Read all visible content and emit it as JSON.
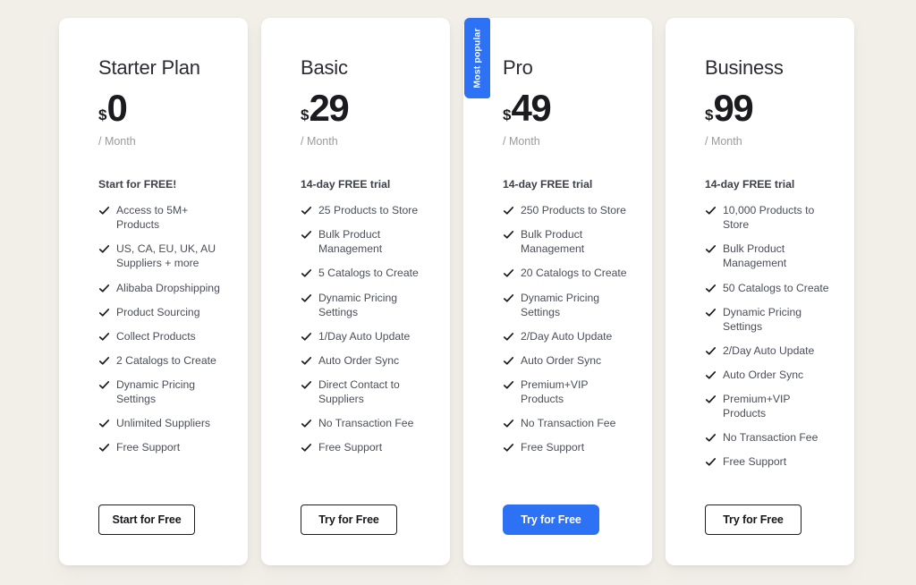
{
  "theme": {
    "page_background": "#f2efe9",
    "card_background": "#ffffff",
    "accent_blue": "#2d71f5",
    "text_dark": "#1a1a1f",
    "text_muted": "#9a9a9f",
    "feature_text": "#4a4f58"
  },
  "plans": [
    {
      "name": "Starter Plan",
      "currency": "$",
      "amount": "0",
      "period": "/ Month",
      "trial": "Start for FREE!",
      "badge": null,
      "features": [
        "Access to 5M+ Products",
        "US, CA, EU, UK, AU Suppliers + more",
        "Alibaba Dropshipping",
        "Product Sourcing",
        "Collect Products",
        "2 Catalogs to Create",
        "Dynamic Pricing Settings",
        "Unlimited Suppliers",
        "Free Support"
      ],
      "cta_label": "Start for Free",
      "cta_style": "outline"
    },
    {
      "name": "Basic",
      "currency": "$",
      "amount": "29",
      "period": "/ Month",
      "trial": "14-day FREE trial",
      "badge": null,
      "features": [
        "25 Products to Store",
        "Bulk Product Management",
        "5 Catalogs to Create",
        "Dynamic Pricing Settings",
        "1/Day Auto Update",
        "Auto Order Sync",
        "Direct Contact to Suppliers",
        "No Transaction Fee",
        "Free Support"
      ],
      "cta_label": "Try for Free",
      "cta_style": "outline"
    },
    {
      "name": "Pro",
      "currency": "$",
      "amount": "49",
      "period": "/ Month",
      "trial": "14-day FREE trial",
      "badge": "Most popular",
      "features": [
        "250 Products to Store",
        "Bulk Product Management",
        "20 Catalogs to Create",
        "Dynamic Pricing Settings",
        "2/Day Auto Update",
        "Auto Order Sync",
        "Premium+VIP Products",
        "No Transaction Fee",
        "Free Support"
      ],
      "cta_label": "Try for Free",
      "cta_style": "solid"
    },
    {
      "name": "Business",
      "currency": "$",
      "amount": "99",
      "period": "/ Month",
      "trial": "14-day FREE trial",
      "badge": null,
      "features": [
        "10,000 Products to Store",
        "Bulk Product Management",
        "50 Catalogs to Create",
        "Dynamic Pricing Settings",
        "2/Day Auto Update",
        "Auto Order Sync",
        "Premium+VIP Products",
        "No Transaction Fee",
        "Free Support"
      ],
      "cta_label": "Try for Free",
      "cta_style": "outline"
    }
  ],
  "icons": {
    "check": "check-icon"
  }
}
